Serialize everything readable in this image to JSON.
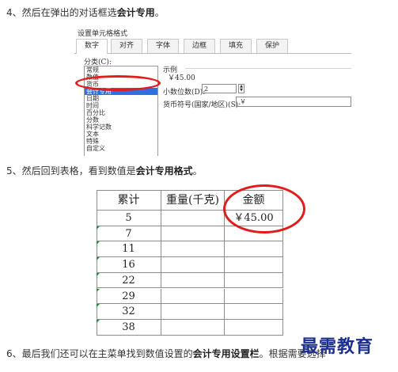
{
  "steps": {
    "s4": {
      "prefix": "4、然后在弹出的对话框选",
      "bold": "会计专用",
      "suffix": "。"
    },
    "s5": {
      "prefix": "5、然后回到表格，看到数值是",
      "bold": "会计专用格式",
      "suffix": "。"
    },
    "s6": {
      "prefix": "6、最后我们还可以在主菜单找到数值设置的",
      "bold": "会计专用设置栏",
      "suffix": "。根据需要选择"
    }
  },
  "dialog": {
    "title": "设置单元格格式",
    "tabs": [
      "数字",
      "对齐",
      "字体",
      "边框",
      "填充",
      "保护"
    ],
    "active_tab": "数字",
    "category_label": "分类(C):",
    "categories": [
      "常规",
      "数值",
      "货币",
      "会计专用",
      "日期",
      "时间",
      "百分比",
      "分数",
      "科学记数",
      "文本",
      "特殊",
      "自定义"
    ],
    "selected_category": "会计专用",
    "sample_label": "示例",
    "sample_value": "￥45.00",
    "decimal_label": "小数位数(D):",
    "decimal_value": "2",
    "currency_label": "货币符号(国家/地区)(S):",
    "currency_value": "￥"
  },
  "sheet": {
    "headers": [
      "累计",
      "重量(千克)",
      "金额"
    ],
    "rows": [
      {
        "cum": "5",
        "amount": "￥45.00",
        "flag": false
      },
      {
        "cum": "7",
        "amount": "",
        "flag": true
      },
      {
        "cum": "11",
        "amount": "",
        "flag": true
      },
      {
        "cum": "16",
        "amount": "",
        "flag": true
      },
      {
        "cum": "22",
        "amount": "",
        "flag": true
      },
      {
        "cum": "29",
        "amount": "",
        "flag": true
      },
      {
        "cum": "32",
        "amount": "",
        "flag": true
      },
      {
        "cum": "38",
        "amount": "",
        "flag": true
      }
    ]
  },
  "watermark": "最需教育",
  "colors": {
    "highlight": "#e21c1c",
    "selection": "#2f6fe0",
    "watermark": "#1d2f8c",
    "flag": "#1e8f3a"
  }
}
